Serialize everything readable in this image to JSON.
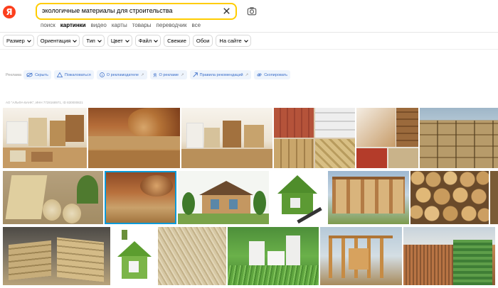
{
  "header": {
    "logo_letter": "Я",
    "search_query": "экологичные материалы для строительства"
  },
  "tabs": [
    {
      "label": "поиск"
    },
    {
      "label": "картинки",
      "active": true
    },
    {
      "label": "видео"
    },
    {
      "label": "карты"
    },
    {
      "label": "товары"
    },
    {
      "label": "переводчик"
    },
    {
      "label": "все"
    }
  ],
  "filters": [
    {
      "label": "Размер",
      "dropdown": true
    },
    {
      "label": "Ориентация",
      "dropdown": true
    },
    {
      "label": "Тип",
      "dropdown": true
    },
    {
      "label": "Цвет",
      "dropdown": true
    },
    {
      "label": "Файл",
      "dropdown": true
    },
    {
      "label": "Свежие",
      "dropdown": false
    },
    {
      "label": "Обои",
      "dropdown": false
    },
    {
      "label": "На сайте",
      "dropdown": true
    }
  ],
  "ad": {
    "label": "Реклама",
    "actions": [
      {
        "label": "Скрыть",
        "icon": "eye-crossed-icon"
      },
      {
        "label": "Пожаловаться",
        "icon": "warning-icon"
      },
      {
        "label": "О рекламодателе",
        "icon": "info-icon"
      },
      {
        "label": "О рекламе",
        "icon": "yandex-icon"
      },
      {
        "label": "Правила рекомендаций",
        "icon": "arrow-icon"
      },
      {
        "label": "Скопировать",
        "icon": "link-icon"
      }
    ],
    "legal": "АО \"АЛЬФА-БАНК\", ИНН 7728168971, ID 830000821"
  },
  "colors": {
    "brand": "#fc3f1d",
    "search_border": "#ffcc00",
    "ad_text": "#3b6ec9"
  },
  "images": [
    {
      "desc": "eco insulation materials and logs",
      "row": 1
    },
    {
      "desc": "wood fiber boards and log cut",
      "row": 1
    },
    {
      "desc": "insulation samples display",
      "row": 1
    },
    {
      "desc": "bricks, blocks and chips",
      "row": 1
    },
    {
      "desc": "materials collage",
      "row": 1
    },
    {
      "desc": "hemp blocks wall",
      "row": 1
    },
    {
      "desc": "hemp fiber rolls",
      "row": 2
    },
    {
      "desc": "wood fiber and timber",
      "row": 2
    },
    {
      "desc": "eco house cutaway",
      "row": 2
    },
    {
      "desc": "grass house with hammer",
      "row": 2
    },
    {
      "desc": "timber frame with straw",
      "row": 2
    },
    {
      "desc": "log ends stack",
      "row": 2
    },
    {
      "desc": "fiberboard stacks",
      "row": 3
    },
    {
      "desc": "green grass house",
      "row": 3
    },
    {
      "desc": "hemp fiber closeup",
      "row": 3
    },
    {
      "desc": "white blocks on grass",
      "row": 3
    },
    {
      "desc": "wooden frame house",
      "row": 3
    },
    {
      "desc": "green wall building",
      "row": 3
    }
  ]
}
